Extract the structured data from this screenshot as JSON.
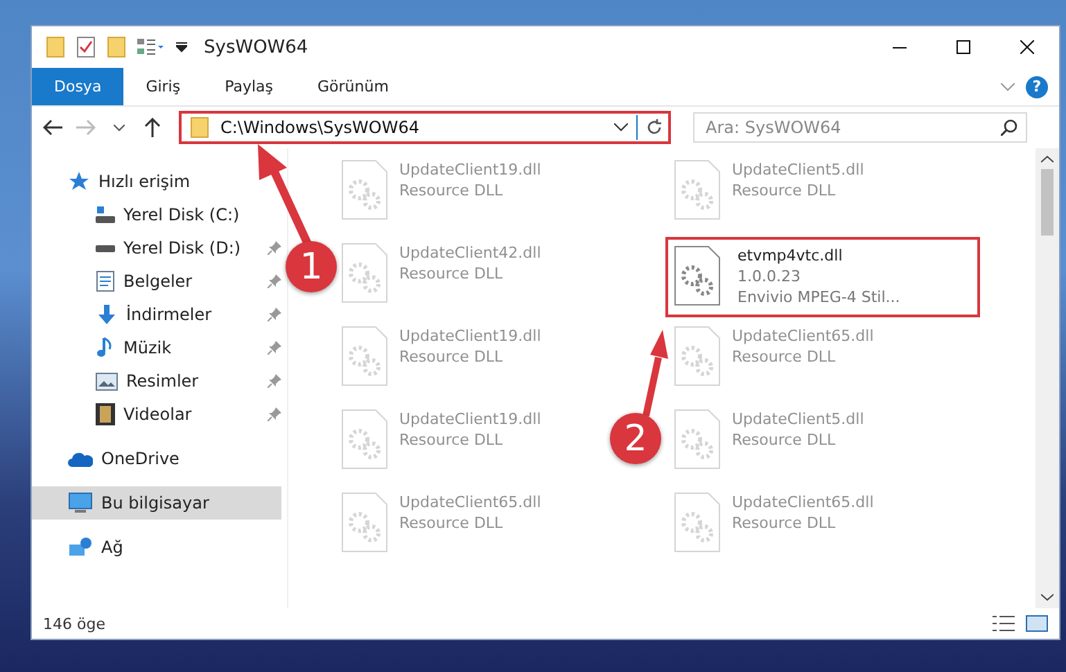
{
  "window": {
    "title": "SysWOW64"
  },
  "ribbon": {
    "tabs": [
      {
        "label": "Dosya",
        "selected": true
      },
      {
        "label": "Giriş",
        "selected": false
      },
      {
        "label": "Paylaş",
        "selected": false
      },
      {
        "label": "Görünüm",
        "selected": false
      }
    ],
    "help": "?"
  },
  "address": {
    "path": "C:\\Windows\\SysWOW64",
    "highlighted": true
  },
  "search": {
    "placeholder": "Ara: SysWOW64"
  },
  "sidebar": {
    "items": [
      {
        "label": "Hızlı erişim",
        "kind": "star",
        "selected": false,
        "children": [
          {
            "label": "Yerel Disk (C:)",
            "kind": "drive-c",
            "pinned": false,
            "selected": false
          },
          {
            "label": "Yerel Disk (D:)",
            "kind": "drive",
            "pinned": true,
            "selected": false
          },
          {
            "label": "Belgeler",
            "kind": "doc",
            "pinned": true,
            "selected": false
          },
          {
            "label": "İndirmeler",
            "kind": "down",
            "pinned": true,
            "selected": false
          },
          {
            "label": "Müzik",
            "kind": "music",
            "pinned": true,
            "selected": false
          },
          {
            "label": "Resimler",
            "kind": "image",
            "pinned": true,
            "selected": false
          },
          {
            "label": "Videolar",
            "kind": "video",
            "pinned": true,
            "selected": false
          }
        ]
      },
      {
        "label": "OneDrive",
        "kind": "cloud",
        "selected": false
      },
      {
        "label": "Bu bilgisayar",
        "kind": "pc",
        "selected": true
      },
      {
        "label": "Ağ",
        "kind": "net",
        "selected": false
      }
    ]
  },
  "files": [
    {
      "name": "UpdateClient19.dll",
      "lines": [
        "Resource DLL"
      ],
      "highlighted": false
    },
    {
      "name": "UpdateClient5.dll",
      "lines": [
        "Resource DLL"
      ],
      "highlighted": false
    },
    {
      "name": "UpdateClient42.dll",
      "lines": [
        "Resource DLL"
      ],
      "highlighted": false
    },
    {
      "name": "etvmp4vtc.dll",
      "lines": [
        "1.0.0.23",
        "Envivio MPEG-4 Stil..."
      ],
      "highlighted": true
    },
    {
      "name": "UpdateClient19.dll",
      "lines": [
        "Resource DLL"
      ],
      "highlighted": false
    },
    {
      "name": "UpdateClient65.dll",
      "lines": [
        "Resource DLL"
      ],
      "highlighted": false
    },
    {
      "name": "UpdateClient19.dll",
      "lines": [
        "Resource DLL"
      ],
      "highlighted": false
    },
    {
      "name": "UpdateClient5.dll",
      "lines": [
        "Resource DLL"
      ],
      "highlighted": false
    },
    {
      "name": "UpdateClient65.dll",
      "lines": [
        "Resource DLL"
      ],
      "highlighted": false
    },
    {
      "name": "UpdateClient65.dll",
      "lines": [
        "Resource DLL"
      ],
      "highlighted": false
    }
  ],
  "status_bar": {
    "count": "146 öge"
  },
  "annotations": [
    {
      "label": "1"
    },
    {
      "label": "2"
    }
  ]
}
